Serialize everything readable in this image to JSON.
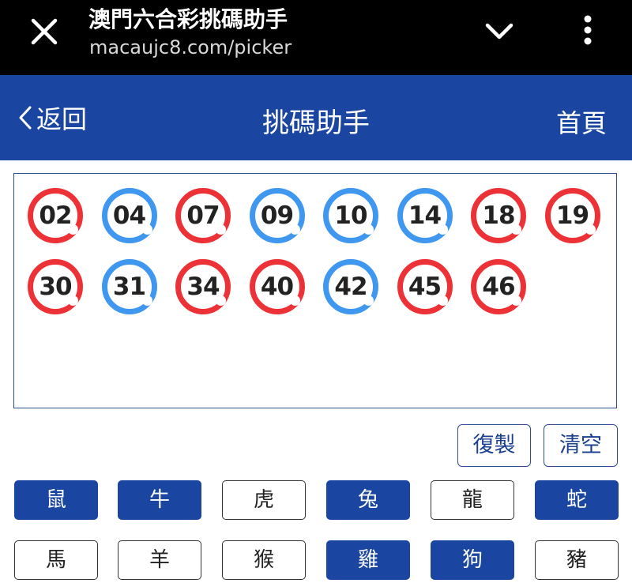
{
  "browser": {
    "title": "澳門六合彩挑碼助手",
    "url": "macaujc8.com/picker"
  },
  "nav": {
    "back_label": "返回",
    "title": "挑碼助手",
    "home_label": "首頁"
  },
  "balls": [
    {
      "num": "02",
      "color": "red"
    },
    {
      "num": "04",
      "color": "blue"
    },
    {
      "num": "07",
      "color": "red"
    },
    {
      "num": "09",
      "color": "blue"
    },
    {
      "num": "10",
      "color": "blue"
    },
    {
      "num": "14",
      "color": "blue"
    },
    {
      "num": "18",
      "color": "red"
    },
    {
      "num": "19",
      "color": "red"
    },
    {
      "num": "30",
      "color": "red"
    },
    {
      "num": "31",
      "color": "blue"
    },
    {
      "num": "34",
      "color": "red"
    },
    {
      "num": "40",
      "color": "red"
    },
    {
      "num": "42",
      "color": "blue"
    },
    {
      "num": "45",
      "color": "red"
    },
    {
      "num": "46",
      "color": "red"
    }
  ],
  "actions": {
    "copy_label": "復製",
    "clear_label": "清空"
  },
  "zodiacs": [
    {
      "label": "鼠",
      "selected": true
    },
    {
      "label": "牛",
      "selected": true
    },
    {
      "label": "虎",
      "selected": false
    },
    {
      "label": "兔",
      "selected": true
    },
    {
      "label": "龍",
      "selected": false
    },
    {
      "label": "蛇",
      "selected": true
    },
    {
      "label": "馬",
      "selected": false
    },
    {
      "label": "羊",
      "selected": false
    },
    {
      "label": "猴",
      "selected": false
    },
    {
      "label": "雞",
      "selected": true
    },
    {
      "label": "狗",
      "selected": true
    },
    {
      "label": "豬",
      "selected": false
    }
  ],
  "colors": {
    "brand_blue": "#1a46a2",
    "ball_red": "#ec3237",
    "ball_blue": "#3f97ef"
  }
}
